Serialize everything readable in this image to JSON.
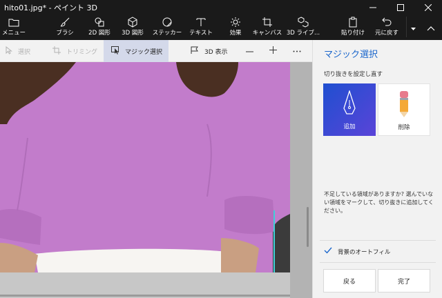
{
  "window": {
    "title": "hito01.jpg* - ペイント 3D",
    "minimize_icon": "minimize-icon",
    "maximize_icon": "maximize-icon",
    "close_icon": "close-icon"
  },
  "ribbon": {
    "items": [
      {
        "label": "メニュー",
        "icon": "folder-icon"
      },
      {
        "label": "ブラシ",
        "icon": "brush-icon"
      },
      {
        "label": "2D 図形",
        "icon": "2d-shapes-icon"
      },
      {
        "label": "3D 図形",
        "icon": "3d-shapes-icon"
      },
      {
        "label": "ステッカー",
        "icon": "sticker-icon"
      },
      {
        "label": "テキスト",
        "icon": "text-icon"
      },
      {
        "label": "効果",
        "icon": "effects-icon"
      },
      {
        "label": "キャンバス",
        "icon": "canvas-icon"
      },
      {
        "label": "3D ライブ...",
        "icon": "3d-library-icon"
      },
      {
        "label": "貼り付け",
        "icon": "paste-icon"
      },
      {
        "label": "元に戻す",
        "icon": "undo-icon"
      }
    ]
  },
  "toolbar": {
    "select_label": "選択",
    "trim_label": "トリミング",
    "magic_select_label": "マジック選択",
    "view_3d_label": "3D 表示",
    "zoom_out": "—",
    "zoom_in": "+",
    "more": "···"
  },
  "panel": {
    "title": "マジック選択",
    "subtitle": "切り抜きを設定し直す",
    "add_label": "追加",
    "remove_label": "削除",
    "info": "不足している領域がありますか? 選んでいない領域をマークして、切り抜きに追加してください。",
    "autofill_label": "背景のオートフィル",
    "autofill_checked": true,
    "back_label": "戻る",
    "done_label": "完了"
  },
  "colors": {
    "accent": "#1a66cc",
    "shirt": "#c27ccb",
    "selection_outline": "#3fd0d8"
  }
}
